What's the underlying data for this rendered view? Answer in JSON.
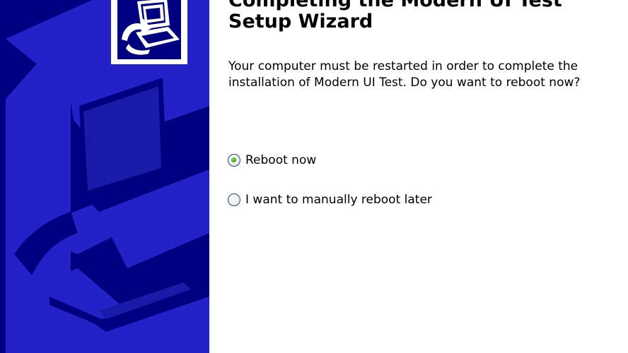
{
  "wizard": {
    "title_line1": "Completing the Modern UI Test",
    "title_line2": "Setup Wizard",
    "message_line1": "Your computer must be restarted in order to complete the",
    "message_line2": "installation of Modern UI Test. Do you want to reboot now?",
    "options": [
      {
        "label": "Reboot now",
        "selected": true
      },
      {
        "label": "I want to manually reboot later",
        "selected": false
      }
    ]
  },
  "colors": {
    "side_panel_background": "#000080",
    "side_panel_art": "#2a2ad8",
    "radio_selected_dot": "#2fa21a"
  },
  "icons": {
    "side_panel_logo": "computer-installer-icon",
    "side_panel_art": "installer-watermark-art"
  }
}
